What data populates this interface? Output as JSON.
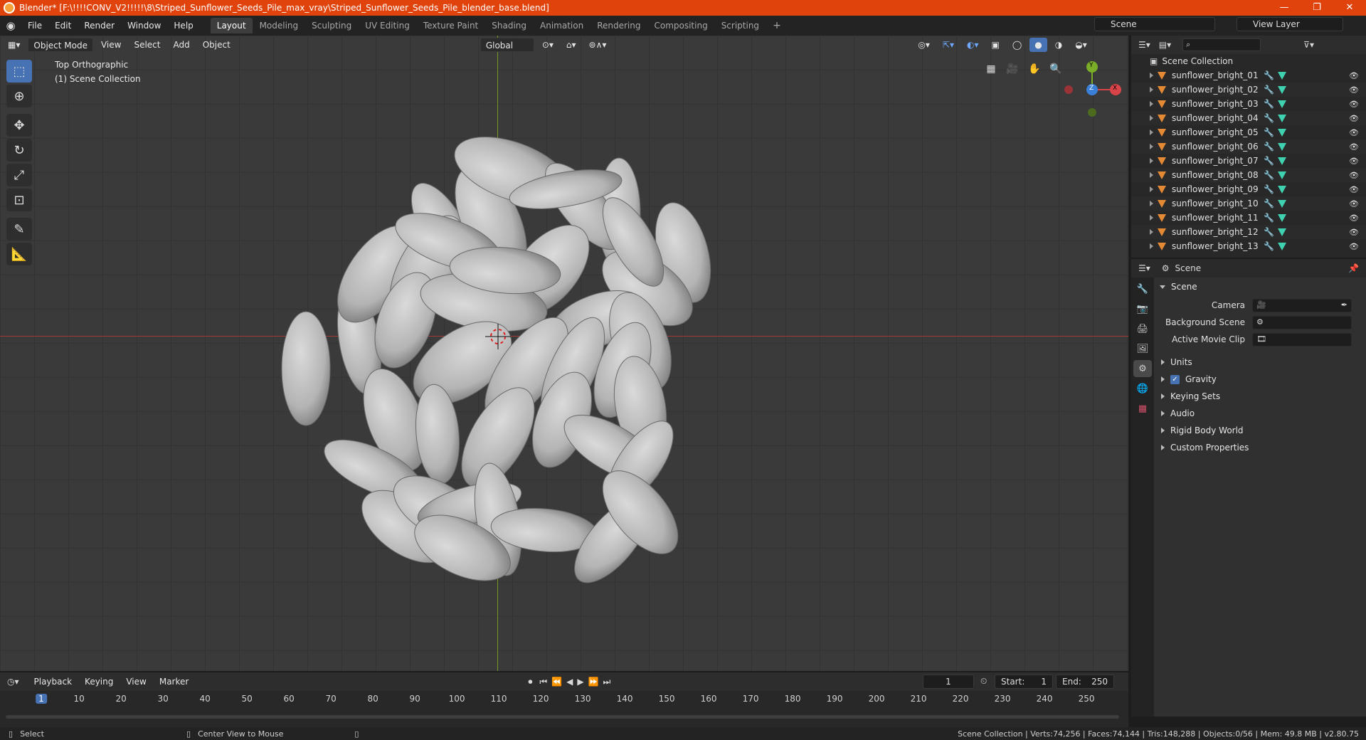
{
  "window": {
    "title": "Blender* [F:\\!!!!CONV_V2!!!!!\\8\\Striped_Sunflower_Seeds_Pile_max_vray\\Striped_Sunflower_Seeds_Pile_blender_base.blend]",
    "controls": [
      "—",
      "❐",
      "✕"
    ]
  },
  "menu": [
    "File",
    "Edit",
    "Render",
    "Window",
    "Help"
  ],
  "workspaces": [
    "Layout",
    "Modeling",
    "Sculpting",
    "UV Editing",
    "Texture Paint",
    "Shading",
    "Animation",
    "Rendering",
    "Compositing",
    "Scripting"
  ],
  "active_workspace": "Layout",
  "scene_selector": {
    "label": "Scene"
  },
  "view_layer_selector": {
    "label": "View Layer"
  },
  "viewport": {
    "mode": "Object Mode",
    "menus": [
      "View",
      "Select",
      "Add",
      "Object"
    ],
    "orientation": "Global",
    "view_name": "Top Orthographic",
    "collection_label": "(1) Scene Collection",
    "gizmo": {
      "x": "X",
      "y": "Y",
      "z": "Z"
    }
  },
  "outliner": {
    "root": "Scene Collection",
    "items": [
      "sunflower_bright_01",
      "sunflower_bright_02",
      "sunflower_bright_03",
      "sunflower_bright_04",
      "sunflower_bright_05",
      "sunflower_bright_06",
      "sunflower_bright_07",
      "sunflower_bright_08",
      "sunflower_bright_09",
      "sunflower_bright_10",
      "sunflower_bright_11",
      "sunflower_bright_12",
      "sunflower_bright_13"
    ]
  },
  "properties": {
    "context": "Scene",
    "panel": "Scene",
    "fields": [
      {
        "label": "Camera"
      },
      {
        "label": "Background Scene"
      },
      {
        "label": "Active Movie Clip"
      }
    ],
    "subpanels": [
      "Units",
      "Gravity",
      "Keying Sets",
      "Audio",
      "Rigid Body World",
      "Custom Properties"
    ],
    "gravity_checked": true
  },
  "timeline": {
    "menus": [
      "Playback",
      "Keying",
      "View",
      "Marker"
    ],
    "current_frame": "1",
    "start_label": "Start:",
    "start": "1",
    "end_label": "End:",
    "end": "250",
    "ticks": [
      "1",
      "10",
      "20",
      "30",
      "40",
      "50",
      "60",
      "70",
      "80",
      "90",
      "100",
      "110",
      "120",
      "130",
      "140",
      "150",
      "160",
      "170",
      "180",
      "190",
      "200",
      "210",
      "220",
      "230",
      "240",
      "250"
    ]
  },
  "statusbar": {
    "left": "Select",
    "middle": "Center View to Mouse",
    "right": "Scene Collection | Verts:74,256 | Faces:74,144 | Tris:148,288 | Objects:0/56 | Mem: 49.8 MB | v2.80.75"
  }
}
